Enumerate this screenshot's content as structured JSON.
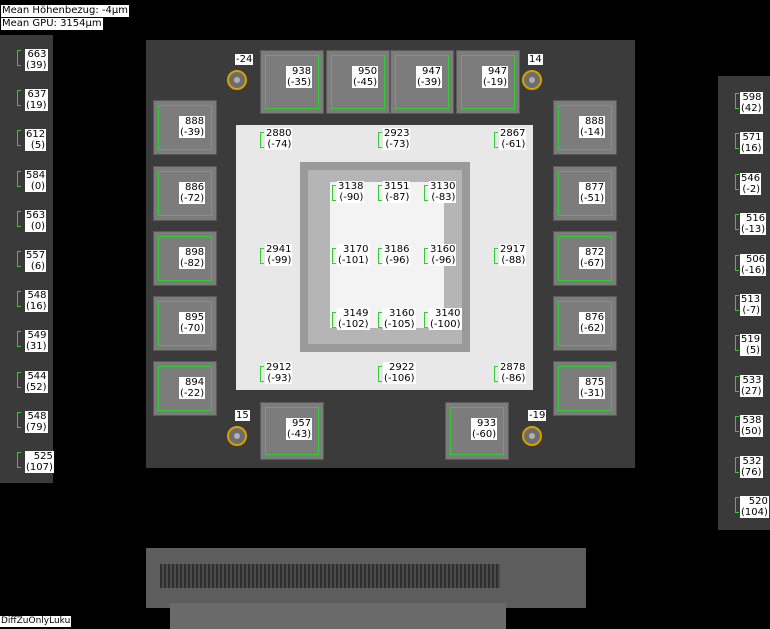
{
  "header": {
    "mean_height": "Mean Höhenbezug: -4µm",
    "mean_gpu": "Mean GPU: 3154µm"
  },
  "footer": {
    "label": "DiffZuOnlyLuku"
  },
  "left_strip": [
    {
      "v": "663",
      "d": "(39)"
    },
    {
      "v": "637",
      "d": "(19)"
    },
    {
      "v": "612",
      "d": "(5)"
    },
    {
      "v": "584",
      "d": "(0)"
    },
    {
      "v": "563",
      "d": "(0)"
    },
    {
      "v": "557",
      "d": "(6)"
    },
    {
      "v": "548",
      "d": "(16)"
    },
    {
      "v": "549",
      "d": "(31)"
    },
    {
      "v": "544",
      "d": "(52)"
    },
    {
      "v": "548",
      "d": "(79)"
    },
    {
      "v": "525",
      "d": "(107)"
    }
  ],
  "right_strip": [
    {
      "v": "598",
      "d": "(42)"
    },
    {
      "v": "571",
      "d": "(16)"
    },
    {
      "v": "546",
      "d": "(-2)"
    },
    {
      "v": "516",
      "d": "(-13)"
    },
    {
      "v": "506",
      "d": "(-16)"
    },
    {
      "v": "513",
      "d": "(-7)"
    },
    {
      "v": "519",
      "d": "(5)"
    },
    {
      "v": "533",
      "d": "(27)"
    },
    {
      "v": "538",
      "d": "(50)"
    },
    {
      "v": "532",
      "d": "(76)"
    },
    {
      "v": "520",
      "d": "(104)"
    }
  ],
  "mem_top": [
    {
      "v": "938",
      "d": "(-35)"
    },
    {
      "v": "950",
      "d": "(-45)"
    },
    {
      "v": "947",
      "d": "(-39)"
    },
    {
      "v": "947",
      "d": "(-19)"
    }
  ],
  "mem_left": [
    {
      "v": "888",
      "d": "(-39)"
    },
    {
      "v": "886",
      "d": "(-72)"
    },
    {
      "v": "898",
      "d": "(-82)"
    },
    {
      "v": "895",
      "d": "(-70)"
    },
    {
      "v": "894",
      "d": "(-22)"
    }
  ],
  "mem_right": [
    {
      "v": "888",
      "d": "(-14)"
    },
    {
      "v": "877",
      "d": "(-51)"
    },
    {
      "v": "872",
      "d": "(-67)"
    },
    {
      "v": "876",
      "d": "(-62)"
    },
    {
      "v": "875",
      "d": "(-31)"
    }
  ],
  "mem_bottom": [
    {
      "v": "957",
      "d": "(-43)"
    },
    {
      "v": "933",
      "d": "(-60)"
    }
  ],
  "sensors": [
    "-24",
    "14",
    "15",
    "-19"
  ],
  "gpu_outer": [
    {
      "v": "2880",
      "d": "(-74)"
    },
    {
      "v": "2923",
      "d": "(-73)"
    },
    {
      "v": "2867",
      "d": "(-61)"
    },
    {
      "v": "2941",
      "d": "(-99)"
    },
    {
      "v": "2917",
      "d": "(-88)"
    },
    {
      "v": "2912",
      "d": "(-93)"
    },
    {
      "v": "2922",
      "d": "(-106)"
    },
    {
      "v": "2878",
      "d": "(-86)"
    }
  ],
  "gpu_core": [
    {
      "v": "3138",
      "d": "(-90)"
    },
    {
      "v": "3151",
      "d": "(-87)"
    },
    {
      "v": "3130",
      "d": "(-83)"
    },
    {
      "v": "3170",
      "d": "(-101)"
    },
    {
      "v": "3186",
      "d": "(-96)"
    },
    {
      "v": "3160",
      "d": "(-96)"
    },
    {
      "v": "3149",
      "d": "(-102)"
    },
    {
      "v": "3160",
      "d": "(-105)"
    },
    {
      "v": "3140",
      "d": "(-100)"
    }
  ]
}
